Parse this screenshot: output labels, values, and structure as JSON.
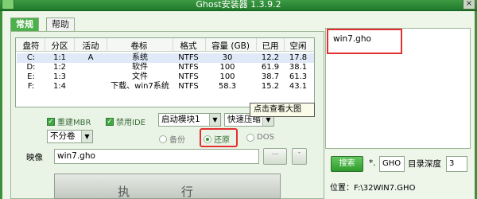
{
  "window": {
    "title": "Ghost安装器 1.3.9.2",
    "close_label": "×"
  },
  "tabs": [
    {
      "label": "常规"
    },
    {
      "label": "帮助"
    }
  ],
  "partition_table": {
    "headers": [
      "盘符",
      "分区",
      "活动",
      "卷标",
      "格式",
      "容量 (GB)",
      "已用",
      "空闲"
    ],
    "rows": [
      [
        "C:",
        "1:1",
        "A",
        "系统",
        "NTFS",
        "30",
        "12.2",
        "17.8"
      ],
      [
        "D:",
        "1:2",
        "",
        "软件",
        "NTFS",
        "100",
        "61.9",
        "38.1"
      ],
      [
        "E:",
        "1:3",
        "",
        "文件",
        "NTFS",
        "100",
        "38.7",
        "61.3"
      ],
      [
        "F:",
        "1:4",
        "",
        "下载、win7系统",
        "NTFS",
        "58.3",
        "15.2",
        "43.1"
      ]
    ]
  },
  "options": {
    "rebuild_mbr": "重建MBR",
    "disable_ide": "禁用IDE",
    "boot_module": "启动模块1",
    "compression": "快速压缩",
    "split": "不分卷"
  },
  "modes": {
    "backup": "备份",
    "restore": "还原",
    "dos": "DOS"
  },
  "tooltip": "点击查看大图",
  "image": {
    "label": "映像",
    "value": "win7.gho",
    "browse_label": "...",
    "extra_label": "-"
  },
  "execute_label": "执 行",
  "search": {
    "button_label": "搜索",
    "ext_prefix": "*.",
    "ext_value": "GHO",
    "depth_label": "目录深度",
    "depth_value": "3",
    "results": [
      "win7.gho"
    ],
    "location_label": "位置：F:\\32WIN7.GHO"
  }
}
